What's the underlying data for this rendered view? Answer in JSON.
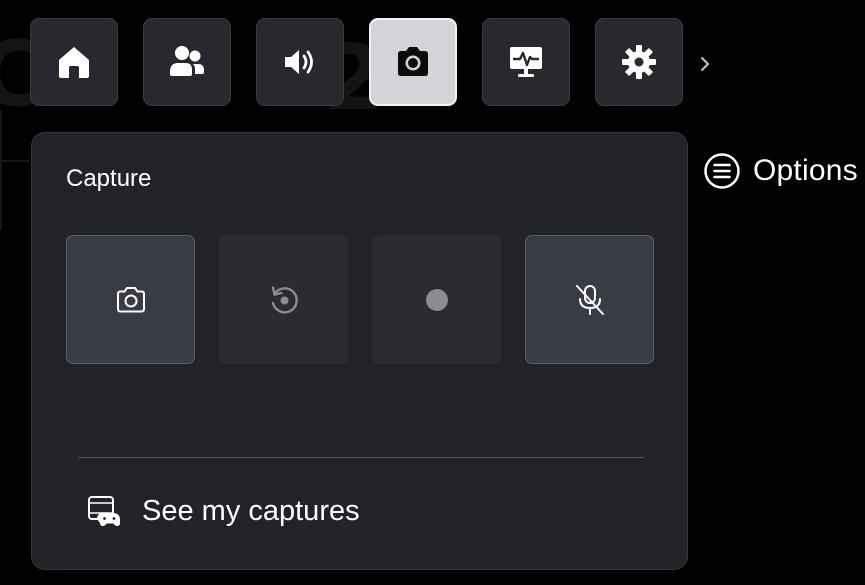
{
  "topbar": {
    "buttons": [
      {
        "id": "home",
        "icon": "home-icon",
        "active": false
      },
      {
        "id": "social",
        "icon": "people-icon",
        "active": false
      },
      {
        "id": "audio",
        "icon": "speaker-icon",
        "active": false
      },
      {
        "id": "capture",
        "icon": "camera-icon",
        "active": true
      },
      {
        "id": "performance",
        "icon": "monitor-pulse-icon",
        "active": false
      },
      {
        "id": "settings",
        "icon": "gear-icon",
        "active": false
      }
    ],
    "more_icon": "chevron-right-icon"
  },
  "options": {
    "label": "Options",
    "icon": "menu-circle-icon"
  },
  "capture_panel": {
    "title": "Capture",
    "actions": [
      {
        "id": "screenshot",
        "icon": "camera-icon",
        "enabled": true
      },
      {
        "id": "record-what-happened",
        "icon": "replay-icon",
        "enabled": false
      },
      {
        "id": "start-recording",
        "icon": "record-dot-icon",
        "enabled": false
      },
      {
        "id": "microphone",
        "icon": "mic-off-icon",
        "enabled": true
      }
    ],
    "see_captures": {
      "label": "See my captures",
      "icon": "gallery-controller-icon"
    }
  },
  "colors": {
    "background": "#000000",
    "panel": "#212328",
    "button": "#27292e",
    "active_button": "#d3d4d8",
    "enabled_action": "#393c44",
    "disabled_action": "#2a2c31",
    "text": "#ffffff",
    "disabled_icon": "#8a8c91"
  }
}
